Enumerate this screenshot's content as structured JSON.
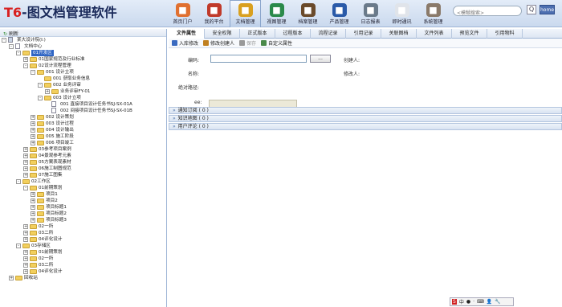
{
  "app": {
    "logo_main": "T6",
    "logo_rest": "-图文档管理软件"
  },
  "nav": [
    {
      "label": "首页门户",
      "icon": "home-icon",
      "color": "#e07030"
    },
    {
      "label": "我的平台",
      "icon": "platform-icon",
      "color": "#c03a2a"
    },
    {
      "label": "文档管理",
      "icon": "folder-icon",
      "color": "#d9a020",
      "active": true
    },
    {
      "label": "视图管理",
      "icon": "globe-icon",
      "color": "#2a8a4a"
    },
    {
      "label": "档案管理",
      "icon": "archive-icon",
      "color": "#6a4a2a"
    },
    {
      "label": "产品管理",
      "icon": "satellite-icon",
      "color": "#2a5aa8"
    },
    {
      "label": "日志报表",
      "icon": "log-icon",
      "color": "#6a7a8a"
    },
    {
      "label": "即时通讯",
      "icon": "chat-icon",
      "color": "#e0e4ea"
    },
    {
      "label": "系统管理",
      "icon": "gear-icon",
      "color": "#8a7a6a"
    }
  ],
  "search": {
    "placeholder": "<模糊搜索>",
    "button": "Q",
    "home": "home"
  },
  "sidebar": {
    "refresh": "刷新"
  },
  "tree": [
    {
      "d": 0,
      "t": "-",
      "k": "root",
      "l": "某大设计院(I:)"
    },
    {
      "d": 1,
      "t": "-",
      "k": "doc",
      "l": "文档中心"
    },
    {
      "d": 2,
      "t": "-",
      "k": "fo",
      "l": "01开发区",
      "sel": true
    },
    {
      "d": 3,
      "t": "+",
      "k": "f",
      "l": "01国家规范及行业标准"
    },
    {
      "d": 3,
      "t": "-",
      "k": "fo",
      "l": "02设计流程管理"
    },
    {
      "d": 4,
      "t": "-",
      "k": "fo",
      "l": "001 设计立项"
    },
    {
      "d": 5,
      "t": "",
      "k": "f",
      "l": "001 获取业务信息"
    },
    {
      "d": 5,
      "t": "-",
      "k": "fo",
      "l": "002 业务评审"
    },
    {
      "d": 6,
      "t": "+",
      "k": "f",
      "l": "业务评审FY-01"
    },
    {
      "d": 5,
      "t": "-",
      "k": "fo",
      "l": "003 设计立项"
    },
    {
      "d": 6,
      "t": "",
      "k": "doc",
      "l": "001 直接项目设计任务书SJ-SX-01A"
    },
    {
      "d": 6,
      "t": "",
      "k": "doc",
      "l": "002 间接项目设计任务书SJ-SX-01B"
    },
    {
      "d": 4,
      "t": "+",
      "k": "f",
      "l": "002 设计策划"
    },
    {
      "d": 4,
      "t": "+",
      "k": "f",
      "l": "003 设计过程"
    },
    {
      "d": 4,
      "t": "+",
      "k": "f",
      "l": "004 设计输出"
    },
    {
      "d": 4,
      "t": "+",
      "k": "f",
      "l": "005 施工阶段"
    },
    {
      "d": 4,
      "t": "+",
      "k": "f",
      "l": "006 项目竣工"
    },
    {
      "d": 3,
      "t": "+",
      "k": "f",
      "l": "03参考项目案例"
    },
    {
      "d": 3,
      "t": "+",
      "k": "f",
      "l": "04景观参考元素"
    },
    {
      "d": 3,
      "t": "+",
      "k": "f",
      "l": "05方案表现素材"
    },
    {
      "d": 3,
      "t": "+",
      "k": "f",
      "l": "06施工制图规范"
    },
    {
      "d": 3,
      "t": "+",
      "k": "f",
      "l": "07施工图集"
    },
    {
      "d": 2,
      "t": "-",
      "k": "fo",
      "l": "02工作区"
    },
    {
      "d": 3,
      "t": "-",
      "k": "fo",
      "l": "01前期策划"
    },
    {
      "d": 4,
      "t": "+",
      "k": "f",
      "l": "项目1"
    },
    {
      "d": 4,
      "t": "+",
      "k": "f",
      "l": "项目2"
    },
    {
      "d": 4,
      "t": "+",
      "k": "f",
      "l": "项目标题1"
    },
    {
      "d": 4,
      "t": "+",
      "k": "f",
      "l": "项目标题2"
    },
    {
      "d": 4,
      "t": "+",
      "k": "f",
      "l": "项目标题3"
    },
    {
      "d": 3,
      "t": "+",
      "k": "f",
      "l": "02一所"
    },
    {
      "d": 3,
      "t": "+",
      "k": "f",
      "l": "03二所"
    },
    {
      "d": 3,
      "t": "+",
      "k": "f",
      "l": "04评化设计"
    },
    {
      "d": 2,
      "t": "-",
      "k": "fo",
      "l": "03存储区"
    },
    {
      "d": 3,
      "t": "+",
      "k": "f",
      "l": "01前期策划"
    },
    {
      "d": 3,
      "t": "+",
      "k": "f",
      "l": "02一所"
    },
    {
      "d": 3,
      "t": "+",
      "k": "f",
      "l": "03二所"
    },
    {
      "d": 3,
      "t": "+",
      "k": "f",
      "l": "04评化设计"
    },
    {
      "d": 1,
      "t": "+",
      "k": "f",
      "l": "回收站"
    }
  ],
  "tabs": [
    "文件属性",
    "安全权限",
    "正式版本",
    "过程版本",
    "流程记录",
    "引用记录",
    "关联图档",
    "文件列表",
    "预览文件",
    "引用物料"
  ],
  "toolbar": [
    {
      "label": "入库修改",
      "icon": "checkin-icon",
      "color": "#3a6ac0"
    },
    {
      "label": "修改创建人",
      "icon": "user-edit-icon",
      "color": "#c08020"
    },
    {
      "label": "保存",
      "icon": "save-icon",
      "color": "#999",
      "disabled": true
    },
    {
      "label": "自定义属性",
      "icon": "custom-attr-icon",
      "color": "#4a8a4a"
    }
  ],
  "form": {
    "code_label": "编码:",
    "create_label": "创建人:",
    "name_label": "名称:",
    "modify_label": "修改人:",
    "path_label": "绝对路径:",
    "ee_label": "ee:",
    "browse_label": "...",
    "code_value": "",
    "ee_value": ""
  },
  "sections": [
    {
      "label": "通知订阅 ( 0 )"
    },
    {
      "label": "知识地图 ( 0 )"
    },
    {
      "label": "用户评论 ( 0 )"
    }
  ],
  "ime": {
    "items": [
      "中",
      "●",
      "·",
      "⌨",
      "👤",
      "🔧"
    ]
  }
}
